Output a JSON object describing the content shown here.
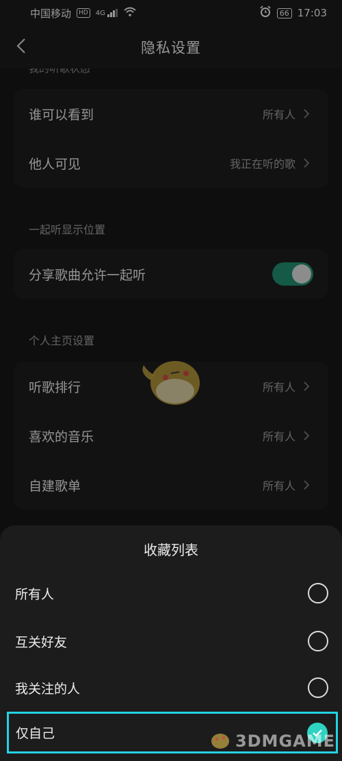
{
  "status_bar": {
    "carrier": "中国移动",
    "hd": "HD",
    "signal": "4G",
    "battery": "66",
    "time": "17:03"
  },
  "header": {
    "title": "隐私设置"
  },
  "sections": {
    "listening_partial": "我的听歌状态",
    "listening": [
      {
        "label": "谁可以看到",
        "value": "所有人"
      },
      {
        "label": "他人可见",
        "value": "我正在听的歌"
      }
    ],
    "listen_together_title": "一起听显示位置",
    "listen_together": {
      "label": "分享歌曲允许一起听",
      "enabled": true
    },
    "profile_title": "个人主页设置",
    "profile": [
      {
        "label": "听歌排行",
        "value": "所有人"
      },
      {
        "label": "喜欢的音乐",
        "value": "所有人"
      },
      {
        "label": "自建歌单",
        "value": "所有人"
      }
    ]
  },
  "sheet": {
    "title": "收藏列表",
    "options": [
      {
        "label": "所有人",
        "selected": false
      },
      {
        "label": "互关好友",
        "selected": false
      },
      {
        "label": "我关注的人",
        "selected": false
      },
      {
        "label": "仅自己",
        "selected": true
      }
    ]
  },
  "watermark": "3DMGAME",
  "colors": {
    "accent_toggle": "#1f8a6e",
    "highlight": "#24d2e4",
    "radio_checked": "#2ed3c2"
  }
}
